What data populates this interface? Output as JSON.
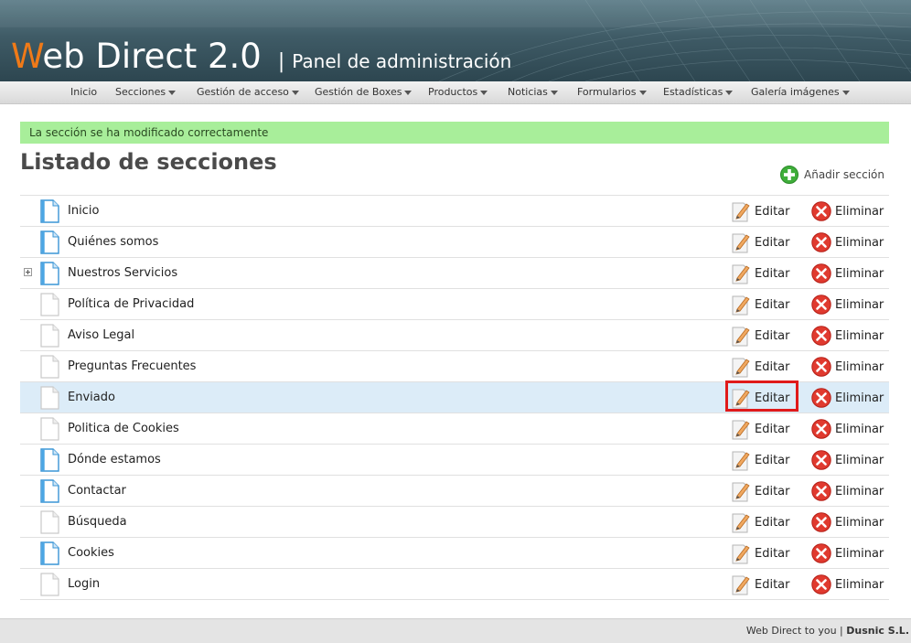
{
  "header": {
    "logo_initial": "W",
    "logo_rest": "eb Direct 2.0",
    "separator": "|",
    "subtitle": "Panel de administración"
  },
  "nav": [
    {
      "label": "Inicio",
      "has_menu": false
    },
    {
      "label": "Secciones",
      "has_menu": true
    },
    {
      "label": "Gestión de acceso",
      "has_menu": true
    },
    {
      "label": "Gestión de Boxes",
      "has_menu": true
    },
    {
      "label": "Productos",
      "has_menu": true
    },
    {
      "label": "Noticias",
      "has_menu": true
    },
    {
      "label": "Formularios",
      "has_menu": true
    },
    {
      "label": "Estadísticas",
      "has_menu": true
    },
    {
      "label": "Galería imágenes",
      "has_menu": true
    }
  ],
  "notice": "La sección se ha modificado correctamente",
  "page_title": "Listado de secciones",
  "add_button": "Añadir sección",
  "actions": {
    "edit": "Editar",
    "delete": "Eliminar"
  },
  "sections": [
    {
      "name": "Inicio",
      "icon": "page-blue-icon"
    },
    {
      "name": "Quiénes somos",
      "icon": "page-blue-icon"
    },
    {
      "name": "Nuestros Servicios",
      "icon": "page-blue-icon",
      "expandable": true
    },
    {
      "name": "Política de Privacidad",
      "icon": "page-white-icon"
    },
    {
      "name": "Aviso Legal",
      "icon": "page-white-icon"
    },
    {
      "name": "Preguntas Frecuentes",
      "icon": "page-white-icon"
    },
    {
      "name": "Enviado",
      "icon": "page-white-icon",
      "highlighted": true
    },
    {
      "name": "Politica de Cookies",
      "icon": "page-white-icon"
    },
    {
      "name": "Dónde estamos",
      "icon": "page-blue-icon"
    },
    {
      "name": "Contactar",
      "icon": "page-blue-icon"
    },
    {
      "name": "Búsqueda",
      "icon": "page-white-icon"
    },
    {
      "name": "Cookies",
      "icon": "page-blue-icon"
    },
    {
      "name": "Login",
      "icon": "page-white-icon"
    }
  ],
  "footer": {
    "text": "Web Direct to you |",
    "company": "Dusnic S.L."
  },
  "colors": {
    "accent": "#f07a18",
    "notice_bg": "#a8ee9a",
    "highlight_row": "#dcecf8",
    "focus_box": "#e01a1a"
  }
}
